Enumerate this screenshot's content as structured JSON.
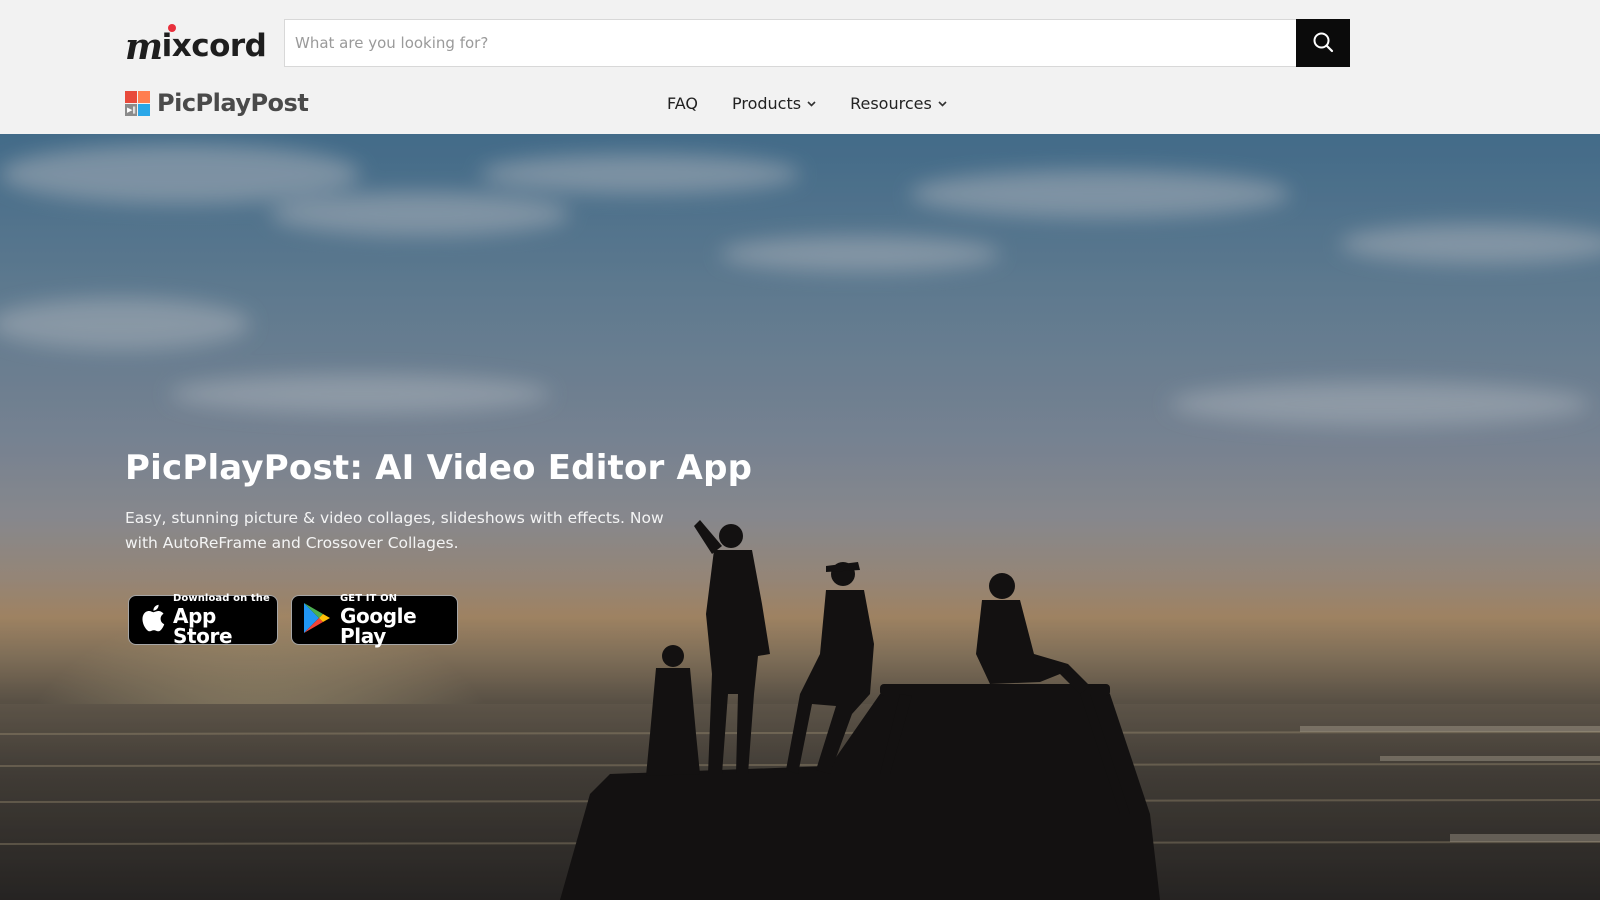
{
  "header": {
    "logo_mixcord_m": "m",
    "logo_mixcord_rest": "ixcord",
    "logo_picplaypost": "PicPlayPost",
    "search": {
      "placeholder": "What are you looking for?",
      "value": ""
    },
    "nav": [
      {
        "label": "FAQ",
        "has_dropdown": false
      },
      {
        "label": "Products",
        "has_dropdown": true
      },
      {
        "label": "Resources",
        "has_dropdown": true
      }
    ]
  },
  "hero": {
    "title": "PicPlayPost: AI Video Editor App",
    "subtitle": "Easy, stunning picture & video collages, slideshows with effects. Now with AutoReFrame and Crossover Collages.",
    "app_store": {
      "small": "Download on the",
      "big": "App Store"
    },
    "google_play": {
      "small": "GET IT ON",
      "big": "Google Play"
    }
  },
  "colors": {
    "brand_dot": "#e8303c",
    "search_button": "#0b0b0b",
    "header_bg": "#f2f2f2"
  },
  "icons": {
    "search": "magnifier-icon",
    "apple": "apple-logo-icon",
    "google_play": "google-play-triangle-icon",
    "dropdown": "chevron-down-icon"
  }
}
